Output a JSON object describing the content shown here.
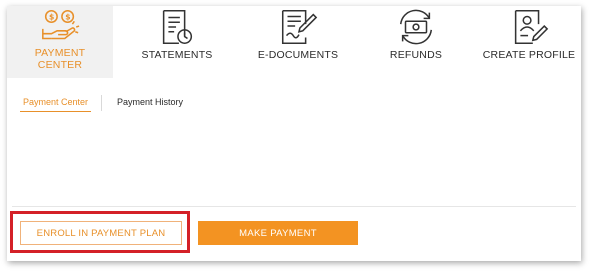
{
  "nav": {
    "items": [
      {
        "label_line1": "PAYMENT",
        "label_line2": "CENTER",
        "icon": "payment-center-icon",
        "active": true
      },
      {
        "label_line1": "STATEMENTS",
        "label_line2": "",
        "icon": "statements-icon",
        "active": false
      },
      {
        "label_line1": "E-DOCUMENTS",
        "label_line2": "",
        "icon": "e-documents-icon",
        "active": false
      },
      {
        "label_line1": "REFUNDS",
        "label_line2": "",
        "icon": "refunds-icon",
        "active": false
      },
      {
        "label_line1": "CREATE PROFILE",
        "label_line2": "",
        "icon": "create-profile-icon",
        "active": false
      }
    ]
  },
  "subtabs": {
    "payment_center": "Payment Center",
    "payment_history": "Payment History"
  },
  "actions": {
    "enroll_label": "ENROLL IN PAYMENT PLAN",
    "make_payment_label": "MAKE PAYMENT"
  },
  "colors": {
    "accent": "#e8902a",
    "primary_button": "#f39322",
    "highlight_border": "#d42027",
    "active_tab_bg": "#f1f1f1"
  }
}
